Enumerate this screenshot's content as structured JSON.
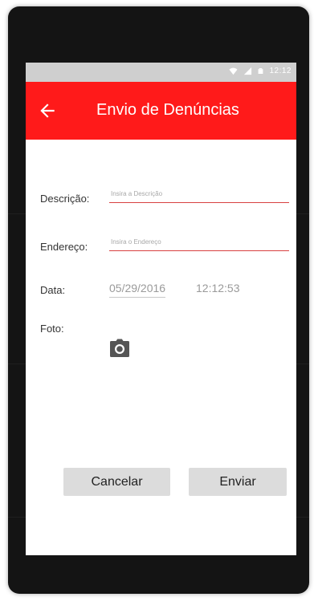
{
  "app_bar": {
    "title": "Envio de Denúncias",
    "color": "#ff1a1a"
  },
  "status_bar": {
    "time": "12:12",
    "icons": [
      "wifi-icon",
      "signal-icon",
      "battery-icon"
    ]
  },
  "form": {
    "description": {
      "label": "Descrição:",
      "placeholder": "Insira a Descrição",
      "value": ""
    },
    "address": {
      "label": "Endereço:",
      "placeholder": "Insira o Endereço",
      "value": ""
    },
    "date": {
      "label": "Data:",
      "value": "05/29/2016"
    },
    "time": {
      "value": "12:12:53"
    },
    "photo": {
      "label": "Foto:",
      "icon": "camera-icon"
    }
  },
  "actions": {
    "cancel_label": "Cancelar",
    "send_label": "Enviar"
  }
}
